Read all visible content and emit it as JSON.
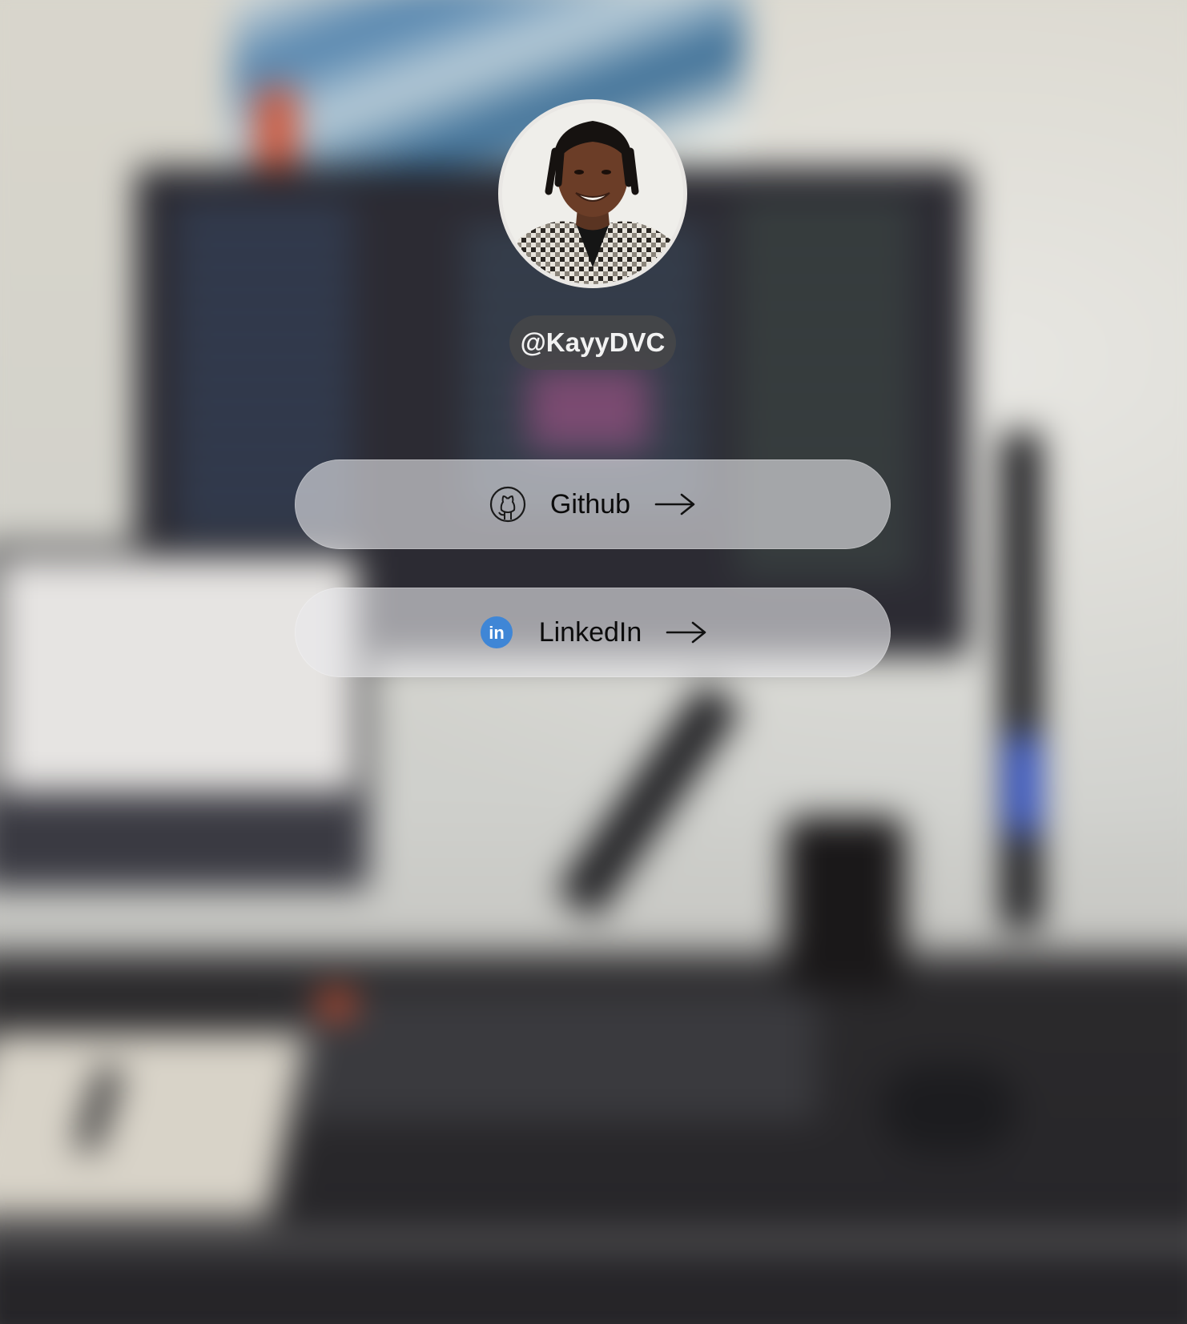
{
  "profile": {
    "handle": "@KayyDVC"
  },
  "links": [
    {
      "label": "Github",
      "icon": "github-icon"
    },
    {
      "label": "LinkedIn",
      "icon": "linkedin-icon"
    }
  ],
  "colors": {
    "linkedin_blue": "#3f86d6",
    "handle_pill": "#464648",
    "button_glass": "#e8e8ec"
  }
}
